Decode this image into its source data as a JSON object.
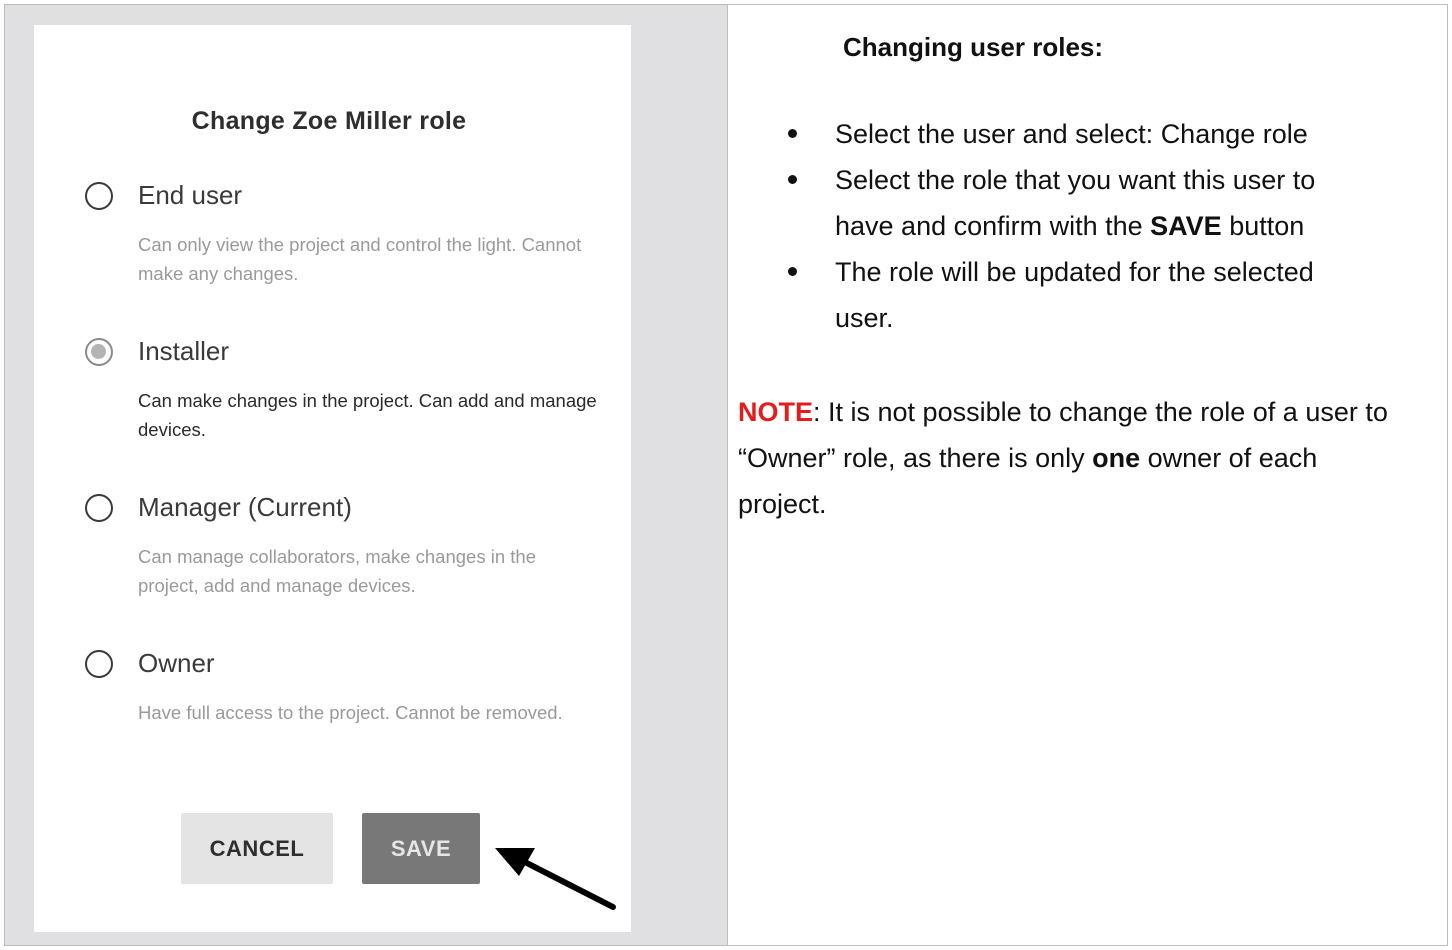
{
  "dialog": {
    "title": "Change Zoe Miller role",
    "options": [
      {
        "label": "End user",
        "description": "Can only view the project and control the light. Cannot make any changes.",
        "selected": false
      },
      {
        "label": "Installer",
        "description": "Can make changes in the project. Can add and manage devices.",
        "selected": true
      },
      {
        "label": "Manager (Current)",
        "description": "Can manage collaborators, make changes in the project, add and manage devices.",
        "selected": false
      },
      {
        "label": "Owner",
        "description": "Have full access to the project. Cannot be removed.",
        "selected": false
      }
    ],
    "cancel_label": "CANCEL",
    "save_label": "SAVE"
  },
  "help": {
    "title": "Changing user roles:",
    "step1": "Select the user and select: Change role",
    "step2_before": "Select the role that you want this user to have and confirm with the ",
    "step2_bold": "SAVE",
    "step2_after": " button",
    "step3": "The role will be updated for the selected user.",
    "note_label": "NOTE",
    "note_part1": ": It is not possible to change the role of a user to “Owner” role, as there is only ",
    "note_bold": "one",
    "note_part2": " owner of each project."
  },
  "colors": {
    "note_label": "#e51c1c",
    "left_background": "#e0e0e2",
    "save_button": "#787878",
    "cancel_button": "#e4e4e4"
  }
}
